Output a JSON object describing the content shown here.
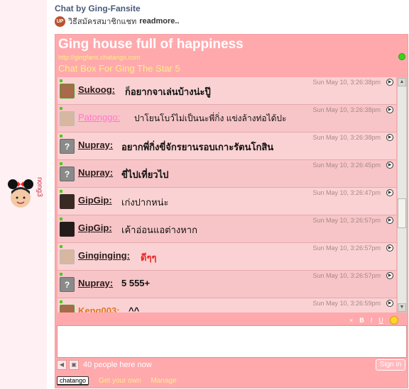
{
  "header": {
    "title": "Chat by Ging-Fansite",
    "up_badge": "UP",
    "subtitle": "วิธีสมัครสมาชิกแชท",
    "readmore": "readmore.."
  },
  "side_text": "nong3",
  "chatbox": {
    "title": "Ging house full of happiness",
    "url": "http://gingfans.chatango.com",
    "description": "Chat Box For Ging The Star 5",
    "messages": [
      {
        "name": "Sukoog:",
        "text": "ก็อยากจาเล่นบ้างน่ะปู๊",
        "time": "Sun May 10, 3:26:38pm"
      },
      {
        "name": "Patonggo:",
        "text": "ปาโยนโบว์ไม่เป็นนะพี่กิ่ง แข่งล้างท่อได้ปะ",
        "time": "Sun May 10, 3:26:38pm"
      },
      {
        "name": "Nupray:",
        "text": "อยากพี่กิ่งขี่จักรยานรอบเกาะรัตนโกสิน",
        "time": "Sun May 10, 3:26:38pm"
      },
      {
        "name": "Nupray:",
        "text": "ขี่ไปเที่ยวไป",
        "time": "Sun May 10, 3:26:45pm"
      },
      {
        "name": "GipGip:",
        "text": "เก่งปากหน่ะ",
        "time": "Sun May 10, 3:26:47pm"
      },
      {
        "name": "GipGip:",
        "text": "เค้าอ่อนแอต่างหาก",
        "time": "Sun May 10, 3:26:57pm"
      },
      {
        "name": "Ginginging:",
        "text": "ดีๆๆ",
        "time": "Sun May 10, 3:26:57pm"
      },
      {
        "name": "Nupray:",
        "text": "5 555+",
        "time": "Sun May 10, 3:26:57pm"
      },
      {
        "name": "Keng003:",
        "text": "^^",
        "time": "Sun May 10, 3:26:59pm"
      }
    ],
    "toolbar": {
      "close": "×",
      "bold": "B",
      "italic": "I",
      "underline": "U"
    },
    "people_count": "40 people here now",
    "signin": "Sign in",
    "chatango": "chatango",
    "get_own": "Get your own",
    "manage": "Manage"
  },
  "colors": {
    "box_bg": "#ffa9ad",
    "title_text": "#ffffff",
    "accent_text": "#ffee88",
    "online_dot": "#3bd21c"
  }
}
